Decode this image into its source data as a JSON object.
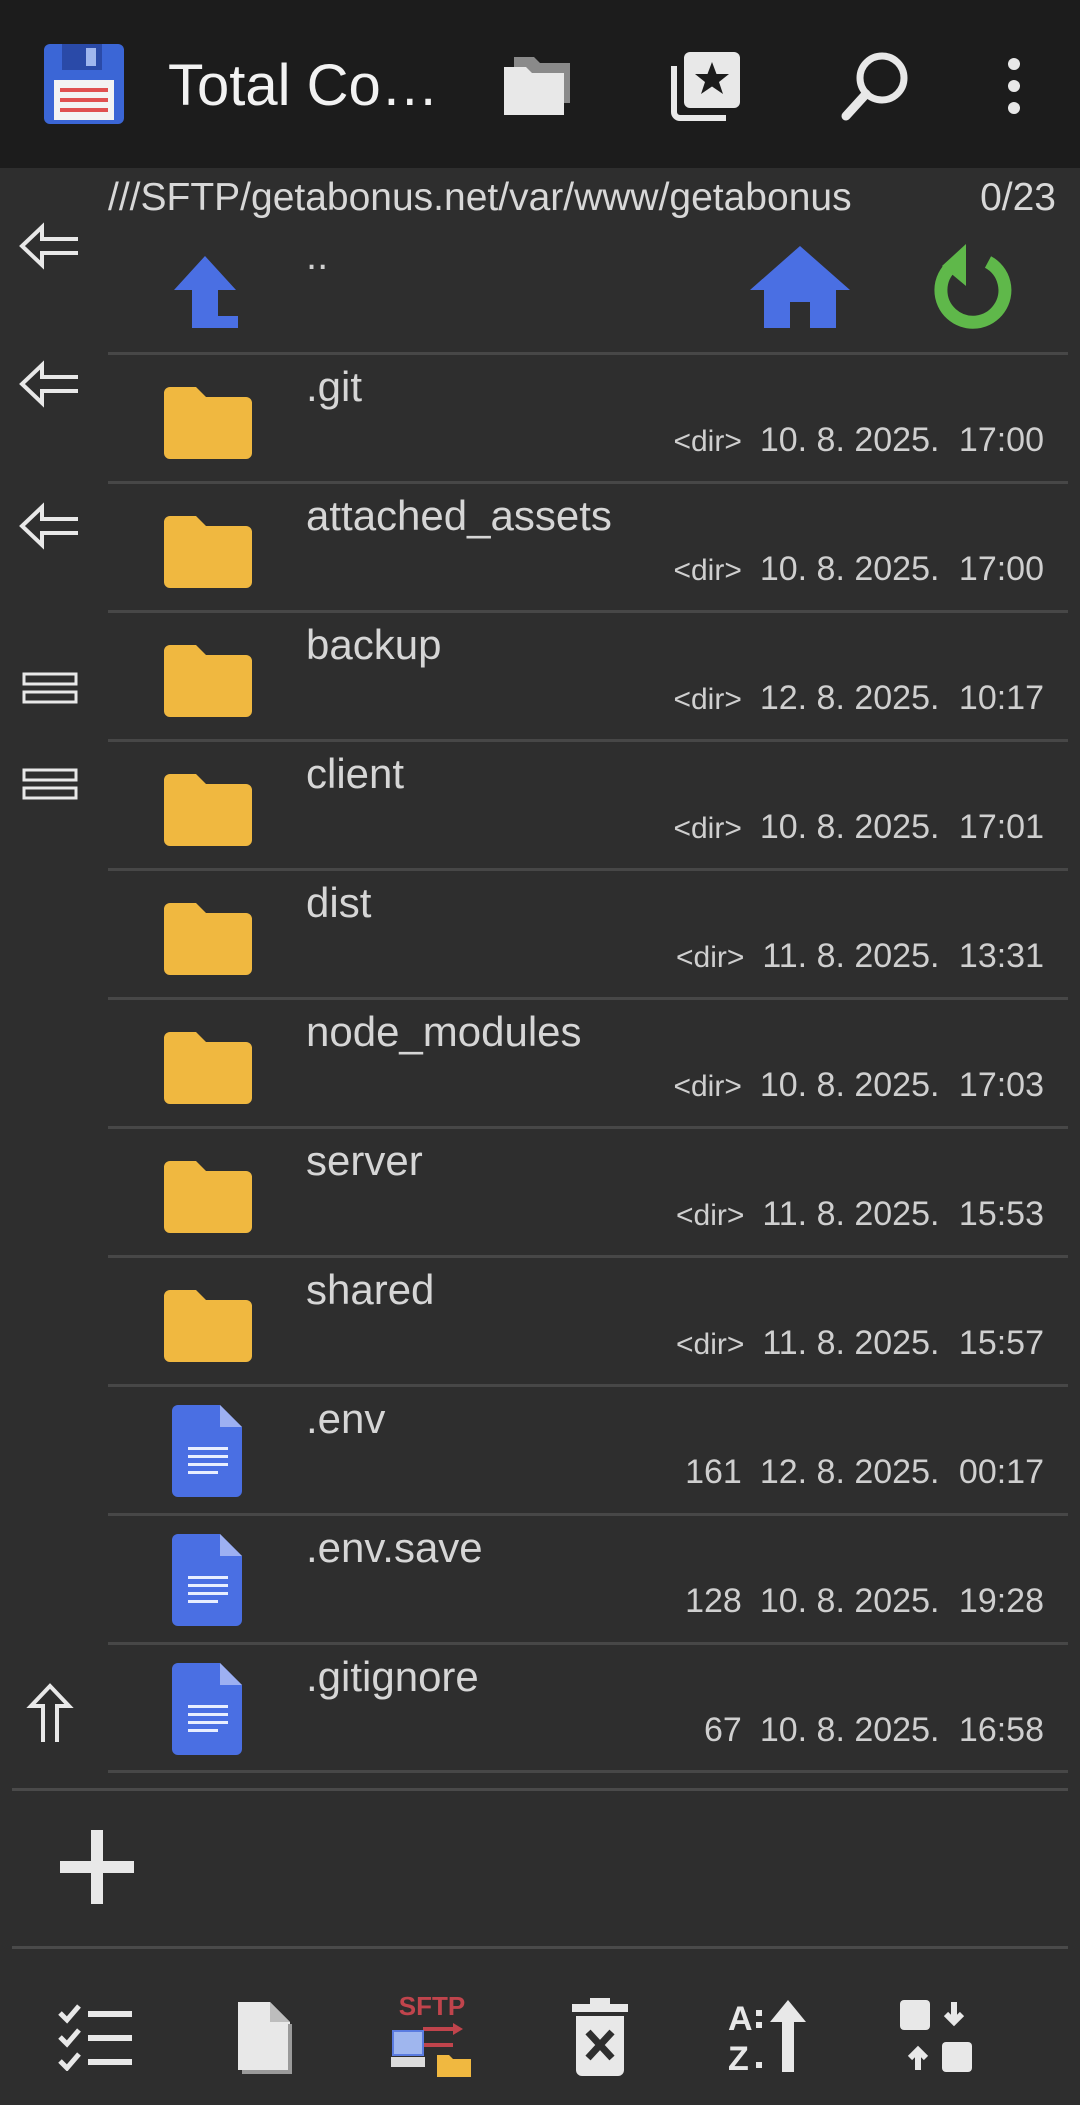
{
  "app": {
    "title": "Total Co…"
  },
  "path": "///SFTP/getabonus.net/var/www/getabonus",
  "selection_count": "0/23",
  "up_label": "..",
  "files": [
    {
      "name": ".git",
      "size": "<dir>",
      "date": "10. 8. 2025.",
      "time": "17:00",
      "type": "folder"
    },
    {
      "name": "attached_assets",
      "size": "<dir>",
      "date": "10. 8. 2025.",
      "time": "17:00",
      "type": "folder"
    },
    {
      "name": "backup",
      "size": "<dir>",
      "date": "12. 8. 2025.",
      "time": "10:17",
      "type": "folder"
    },
    {
      "name": "client",
      "size": "<dir>",
      "date": "10. 8. 2025.",
      "time": "17:01",
      "type": "folder"
    },
    {
      "name": "dist",
      "size": "<dir>",
      "date": "11. 8. 2025.",
      "time": "13:31",
      "type": "folder"
    },
    {
      "name": "node_modules",
      "size": "<dir>",
      "date": "10. 8. 2025.",
      "time": "17:03",
      "type": "folder"
    },
    {
      "name": "server",
      "size": "<dir>",
      "date": "11. 8. 2025.",
      "time": "15:53",
      "type": "folder"
    },
    {
      "name": "shared",
      "size": "<dir>",
      "date": "11. 8. 2025.",
      "time": "15:57",
      "type": "folder"
    },
    {
      "name": ".env",
      "size": "161",
      "date": "12. 8. 2025.",
      "time": "00:17",
      "type": "file"
    },
    {
      "name": ".env.save",
      "size": "128",
      "date": "10. 8. 2025.",
      "time": "19:28",
      "type": "file"
    },
    {
      "name": ".gitignore",
      "size": "67",
      "date": "10. 8. 2025.",
      "time": "16:58",
      "type": "file"
    }
  ],
  "bottom_icons": {
    "sftp_label": "SFTP"
  },
  "colors": {
    "folder": "#f0b840",
    "file": "#4a6fe3",
    "up_arrow": "#4a6fe3",
    "home": "#4a6fe3",
    "refresh": "#5fb84a",
    "sftp_text": "#c0444c"
  }
}
